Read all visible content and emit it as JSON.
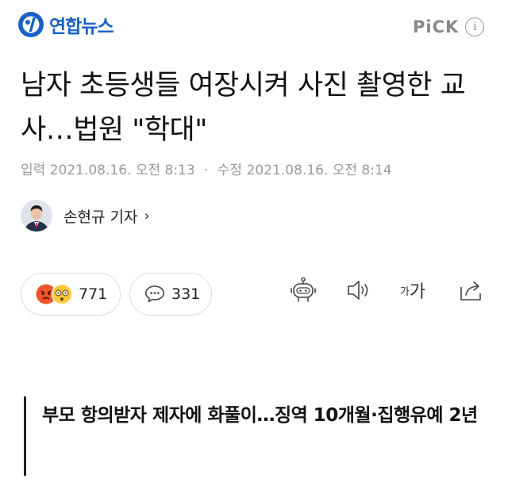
{
  "header": {
    "logo_text": "연합뉴스",
    "pick_label": "PiCK",
    "info_glyph": "i"
  },
  "article": {
    "title": "남자 초등생들 여장시켜 사진 촬영한 교사…법원 \"학대\"",
    "input_label": "입력",
    "input_date": "2021.08.16. 오전 8:13",
    "separator": "·",
    "modified_label": "수정",
    "modified_date": "2021.08.16. 오전 8:14",
    "reporter": "손현규 기자",
    "reporter_chevron": "›",
    "reaction_count": "771",
    "comment_count": "331",
    "font_size_label_small": "가",
    "font_size_label_large": "가",
    "subtitle": "부모 항의받자 제자에 화풀이…징역 10개월·집행유예 2년"
  },
  "icons": {
    "logo": "yonhap-logo-icon",
    "angry": "angry-face-icon",
    "surprised": "surprised-face-icon",
    "comment": "speech-bubble-icon",
    "robot": "robot-icon",
    "speaker": "speaker-icon",
    "share": "share-icon"
  },
  "colors": {
    "brand": "#1761c5",
    "muted": "#9a9a9a",
    "angry": "#f0552a",
    "surprised": "#ffc93c"
  }
}
